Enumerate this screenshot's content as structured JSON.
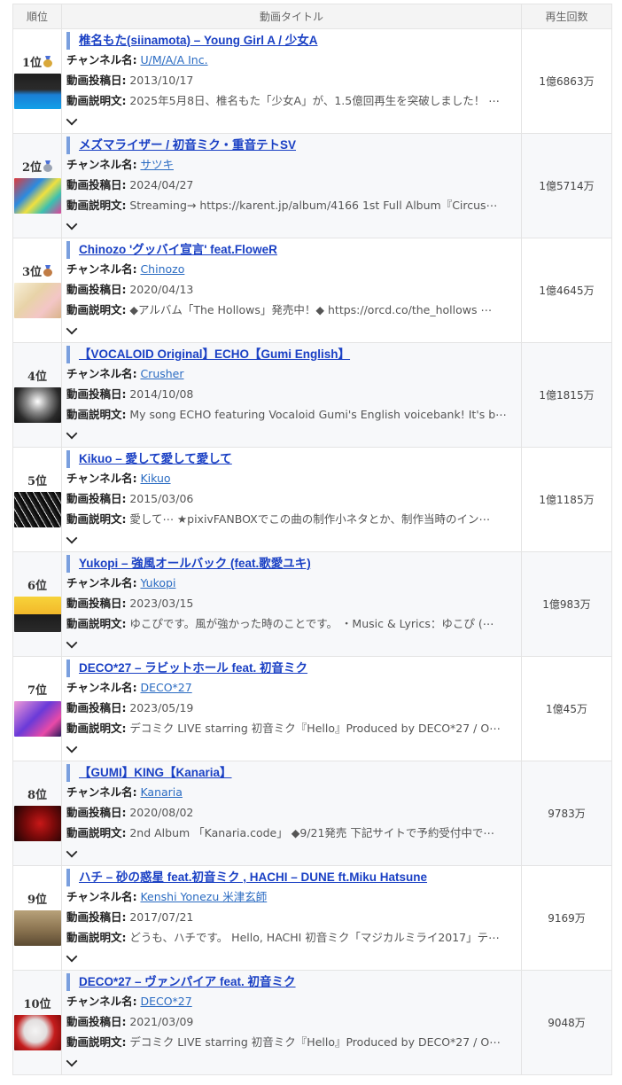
{
  "header": {
    "rank": "順位",
    "title": "動画タイトル",
    "views": "再生回数"
  },
  "labels": {
    "channel": "チャンネル名:",
    "date": "動画投稿日:",
    "desc": "動画説明文:"
  },
  "medal_colors": {
    "gold": "#d9a83a",
    "silver": "#9aa3b3",
    "bronze": "#c07c45"
  },
  "rows": [
    {
      "rank": "1位",
      "medal": "gold",
      "thumb_icon": "thumbnail-image",
      "title": "椎名もた(siinamota) – Young Girl A / 少女A",
      "channel": "U/M/A/A Inc.",
      "date": "2013/10/17",
      "desc": "2025年5月8日、椎名もた「少女A」が、1.5億回再生を突破しました！ ⋯",
      "views": "1億6863万"
    },
    {
      "rank": "2位",
      "medal": "silver",
      "thumb_icon": "thumbnail-image",
      "title": "メズマライザー / 初音ミク・重音テトSV",
      "channel": "サツキ",
      "date": "2024/04/27",
      "desc": "Streaming→ https://karent.jp/album/4166 1st Full Album『Circus⋯",
      "views": "1億5714万"
    },
    {
      "rank": "3位",
      "medal": "bronze",
      "thumb_icon": "thumbnail-image",
      "title": "Chinozo 'グッバイ宣言' feat.FloweR",
      "channel": "Chinozo",
      "date": "2020/04/13",
      "desc": "◆アルバム「The Hollows」発売中！◆ https://orcd.co/the_hollows ⋯",
      "views": "1億4645万"
    },
    {
      "rank": "4位",
      "medal": "",
      "thumb_icon": "thumbnail-image",
      "title": "【VOCALOID Original】ECHO【Gumi English】",
      "channel": "Crusher",
      "date": "2014/10/08",
      "desc": "My song ECHO featuring Vocaloid Gumi's English voicebank! It's b⋯",
      "views": "1億1815万"
    },
    {
      "rank": "5位",
      "medal": "",
      "thumb_icon": "thumbnail-image",
      "title": "Kikuo – 愛して愛して愛して",
      "channel": "Kikuo",
      "date": "2015/03/06",
      "desc": "愛して⋯ ★pixivFANBOXでこの曲の制作小ネタとか、制作当時のイン⋯",
      "views": "1億1185万"
    },
    {
      "rank": "6位",
      "medal": "",
      "thumb_icon": "thumbnail-image",
      "title": "Yukopi – 強風オールバック (feat.歌愛ユキ)",
      "channel": "Yukopi",
      "date": "2023/03/15",
      "desc": "ゆこぴです。風が強かった時のことです。 ・Music & Lyrics：ゆこぴ (⋯",
      "views": "1億983万"
    },
    {
      "rank": "7位",
      "medal": "",
      "thumb_icon": "thumbnail-image",
      "title": "DECO*27 – ラビットホール feat. 初音ミク",
      "channel": "DECO*27",
      "date": "2023/05/19",
      "desc": "デコミク LIVE starring 初音ミク『Hello』Produced by DECO*27 / O⋯",
      "views": "1億45万"
    },
    {
      "rank": "8位",
      "medal": "",
      "thumb_icon": "thumbnail-image",
      "title": "【GUMI】KING【Kanaria】",
      "channel": "Kanaria",
      "date": "2020/08/02",
      "desc": "2nd Album 「Kanaria.code」 ◆9/21発売 下記サイトで予約受付中で⋯",
      "views": "9783万"
    },
    {
      "rank": "9位",
      "medal": "",
      "thumb_icon": "thumbnail-image",
      "title": "ハチ – 砂の惑星 feat.初音ミク , HACHI – DUNE ft.Miku Hatsune",
      "channel": "Kenshi Yonezu 米津玄師",
      "date": "2017/07/21",
      "desc": "どうも、ハチです。 Hello, HACHI 初音ミク「マジカルミライ2017」テ⋯",
      "views": "9169万"
    },
    {
      "rank": "10位",
      "medal": "",
      "thumb_icon": "thumbnail-image",
      "title": "DECO*27 – ヴァンパイア feat. 初音ミク",
      "channel": "DECO*27",
      "date": "2021/03/09",
      "desc": "デコミク LIVE starring 初音ミク『Hello』Produced by DECO*27 / O⋯",
      "views": "9048万"
    }
  ]
}
